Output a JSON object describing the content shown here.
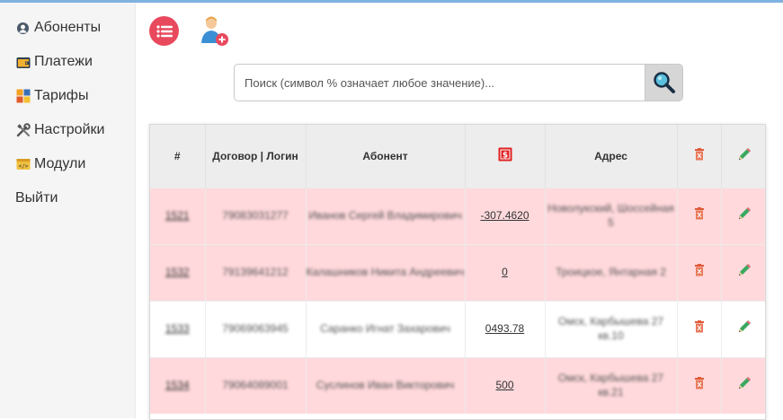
{
  "sidebar": {
    "items": [
      {
        "label": "Абоненты",
        "icon": "user-icon"
      },
      {
        "label": "Платежи",
        "icon": "wallet-icon"
      },
      {
        "label": "Тарифы",
        "icon": "tariffs-icon"
      },
      {
        "label": "Настройки",
        "icon": "tools-icon"
      },
      {
        "label": "Модули",
        "icon": "modules-icon"
      },
      {
        "label": "Выйти",
        "icon": ""
      }
    ]
  },
  "toolbar": {
    "list_icon": "list-icon",
    "add_user_icon": "add-user-icon"
  },
  "search": {
    "placeholder": "Поиск (символ % означает любое значение)...",
    "value": "",
    "icon": "magnifier-icon"
  },
  "table": {
    "headers": {
      "num": "#",
      "contract": "Договор | Логин",
      "subscriber": "Абонент",
      "balance_icon": "money-icon",
      "address": "Адрес",
      "delete_icon": "trash-icon",
      "edit_icon": "pencil-icon"
    },
    "rows": [
      {
        "num": "1521",
        "login": "79083031277",
        "name": "Иванов Сергей Владимирович",
        "balance": "-307.4620",
        "address": "Новолукский, Шоссейная 5",
        "highlight": true
      },
      {
        "num": "1532",
        "login": "79139641212",
        "name": "Калашников Никита Андреевич",
        "balance": "0",
        "address": "Троицкое, Янтарная 2",
        "highlight": true
      },
      {
        "num": "1533",
        "login": "79069063945",
        "name": "Саранко Игнат Захарович",
        "balance": "0493.78",
        "address": "Омск, Карбышева 27 кв.10",
        "highlight": false
      },
      {
        "num": "1534",
        "login": "79064089001",
        "name": "Суслинов Иван Викторович",
        "balance": "500",
        "address": "Омск, Карбышева 27 кв.21",
        "highlight": true
      }
    ]
  },
  "colors": {
    "accent": "#e8495c",
    "row_pink": "#ffd9dc",
    "header_bg": "#ededed",
    "topbar": "#7fb2e0"
  }
}
